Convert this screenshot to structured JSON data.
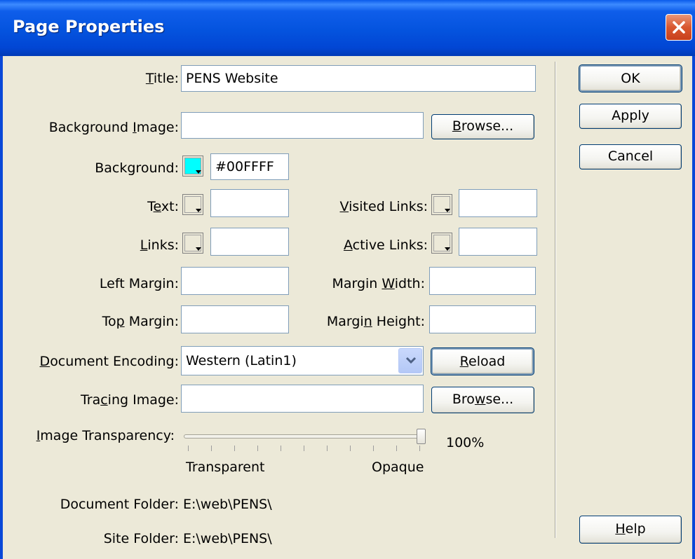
{
  "window": {
    "title": "Page Properties"
  },
  "fields": {
    "title_label": "Title:",
    "title_value": "PENS Website",
    "bg_image_label": "Background Image:",
    "bg_image_value": "",
    "background_label": "Background:",
    "background_value": "#00FFFF",
    "background_color": "#00FFFF",
    "text_label": "Text:",
    "text_value": "",
    "visited_label": "Visited Links:",
    "visited_value": "",
    "links_label": "Links:",
    "links_value": "",
    "active_label": "Active Links:",
    "active_value": "",
    "left_margin_label": "Left Margin:",
    "left_margin_value": "",
    "margin_width_label": "Margin Width:",
    "margin_width_value": "",
    "top_margin_label": "Top Margin:",
    "top_margin_value": "",
    "margin_height_label": "Margin Height:",
    "margin_height_value": "",
    "encoding_label": "Document Encoding:",
    "encoding_value": "Western (Latin1)",
    "tracing_label": "Tracing Image:",
    "tracing_value": ""
  },
  "transparency": {
    "label": "Image Transparency:",
    "value_text": "100%",
    "value": 1.0,
    "min_label": "Transparent",
    "max_label": "Opaque"
  },
  "buttons": {
    "ok": "OK",
    "apply": "Apply",
    "cancel": "Cancel",
    "browse": "Browse...",
    "reload": "Reload",
    "help": "Help"
  },
  "info": {
    "doc_folder_label": "Document Folder:",
    "doc_folder_value": "E:\\web\\PENS\\",
    "site_folder_label": "Site Folder:",
    "site_folder_value": "E:\\web\\PENS\\"
  },
  "icons": {
    "close": "close-icon",
    "dropdown": "chevron-down-icon",
    "swatch": "color-swatch-icon"
  }
}
